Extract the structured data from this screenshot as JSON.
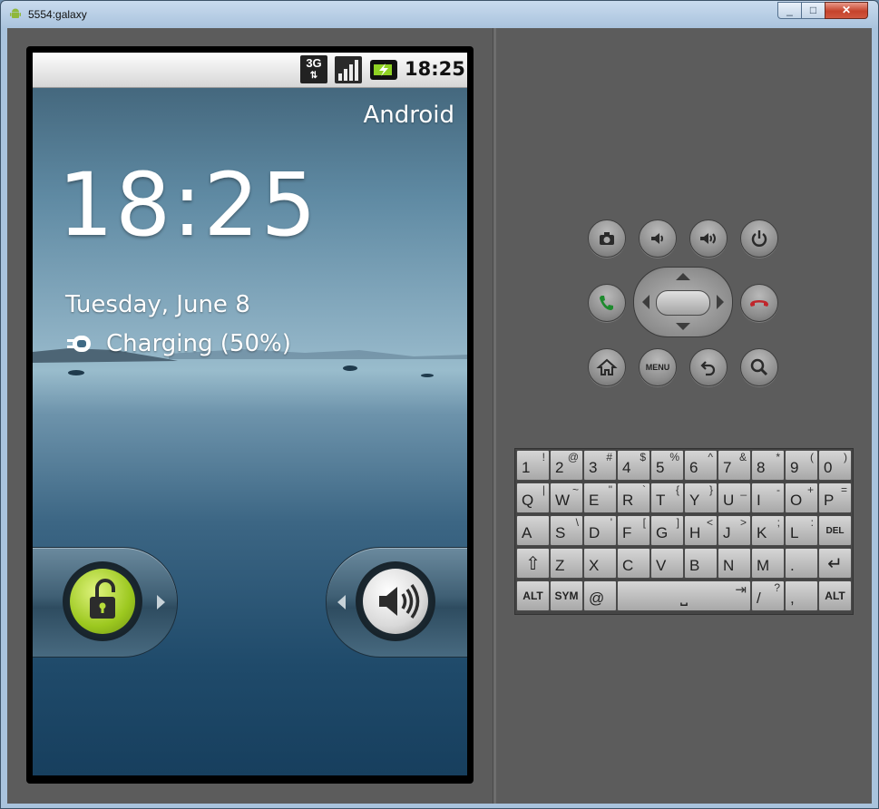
{
  "window": {
    "title": "5554:galaxy"
  },
  "status": {
    "network": "3G",
    "time": "18:25"
  },
  "lockscreen": {
    "carrier": "Android",
    "clock": "18:25",
    "date": "Tuesday, June 8",
    "charging": "Charging (50%)"
  },
  "keyboard": {
    "rows": [
      [
        {
          "m": "1",
          "s": "!"
        },
        {
          "m": "2",
          "s": "@"
        },
        {
          "m": "3",
          "s": "#"
        },
        {
          "m": "4",
          "s": "$"
        },
        {
          "m": "5",
          "s": "%"
        },
        {
          "m": "6",
          "s": "^"
        },
        {
          "m": "7",
          "s": "&"
        },
        {
          "m": "8",
          "s": "*"
        },
        {
          "m": "9",
          "s": "("
        },
        {
          "m": "0",
          "s": ")"
        }
      ],
      [
        {
          "m": "Q",
          "s": "|"
        },
        {
          "m": "W",
          "s": "~"
        },
        {
          "m": "E",
          "s": "\""
        },
        {
          "m": "R",
          "s": "`"
        },
        {
          "m": "T",
          "s": "{"
        },
        {
          "m": "Y",
          "s": "}"
        },
        {
          "m": "U",
          "s": "_"
        },
        {
          "m": "I",
          "s": "-"
        },
        {
          "m": "O",
          "s": "+"
        },
        {
          "m": "P",
          "s": "="
        }
      ],
      [
        {
          "m": "A",
          "s": ""
        },
        {
          "m": "S",
          "s": "\\"
        },
        {
          "m": "D",
          "s": "'"
        },
        {
          "m": "F",
          "s": "["
        },
        {
          "m": "G",
          "s": "]"
        },
        {
          "m": "H",
          "s": "<"
        },
        {
          "m": "J",
          "s": ">"
        },
        {
          "m": "K",
          "s": ";"
        },
        {
          "m": "L",
          "s": ":"
        },
        {
          "m": "DEL",
          "s": ""
        }
      ],
      [
        {
          "m": "",
          "s": ""
        },
        {
          "m": "Z",
          "s": ""
        },
        {
          "m": "X",
          "s": ""
        },
        {
          "m": "C",
          "s": ""
        },
        {
          "m": "V",
          "s": ""
        },
        {
          "m": "B",
          "s": ""
        },
        {
          "m": "N",
          "s": ""
        },
        {
          "m": "M",
          "s": ""
        },
        {
          "m": ".",
          "s": ""
        },
        {
          "m": "",
          "s": ""
        }
      ]
    ],
    "alt_label": "ALT",
    "sym_label": "SYM",
    "at_label": "@",
    "slash_label": "/",
    "question_label": "?",
    "comma_label": ",",
    "space_symbol": "⎵",
    "tab_symbol": "⇥"
  },
  "colors": {
    "unlock_accent": "#9cc81f",
    "call_green": "#1e8a2e",
    "end_red": "#c0262b"
  }
}
